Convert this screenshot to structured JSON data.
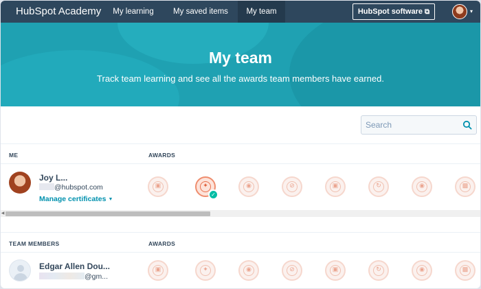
{
  "nav": {
    "brand": "HubSpot Academy",
    "tabs": [
      {
        "label": "My learning"
      },
      {
        "label": "My saved items"
      },
      {
        "label": "My team"
      }
    ],
    "software_button": "HubSpot software",
    "avatar_icon": "user-avatar",
    "caret_icon": "chevron-down-icon"
  },
  "hero": {
    "title": "My team",
    "subtitle": "Track team learning and see all the awards team members have earned."
  },
  "search": {
    "placeholder": "Search",
    "icon": "search-icon"
  },
  "me_section": {
    "header_name": "ME",
    "header_awards": "AWARDS",
    "person": {
      "name": "Joy L...",
      "email_visible": "@hubspot.com",
      "manage_link": "Manage certificates"
    },
    "badges": [
      {
        "earned": false,
        "icon": "badge-icon"
      },
      {
        "earned": true,
        "icon": "badge-icon",
        "checked": true
      },
      {
        "earned": false,
        "icon": "badge-icon"
      },
      {
        "earned": false,
        "icon": "badge-icon"
      },
      {
        "earned": false,
        "icon": "badge-icon"
      },
      {
        "earned": false,
        "icon": "badge-icon"
      },
      {
        "earned": false,
        "icon": "badge-icon"
      },
      {
        "earned": false,
        "icon": "badge-icon"
      }
    ]
  },
  "team_section": {
    "header_name": "TEAM MEMBERS",
    "header_awards": "AWARDS",
    "members": [
      {
        "name": "Edgar Allen Dou...",
        "email_visible": "@gm..."
      }
    ],
    "badge_count": 8
  },
  "colors": {
    "nav_bg": "#2e475d",
    "hero_bg": "#1fa1b2",
    "link": "#0091ae",
    "check": "#00bda5",
    "badge_accent": "#ef8d6e"
  }
}
